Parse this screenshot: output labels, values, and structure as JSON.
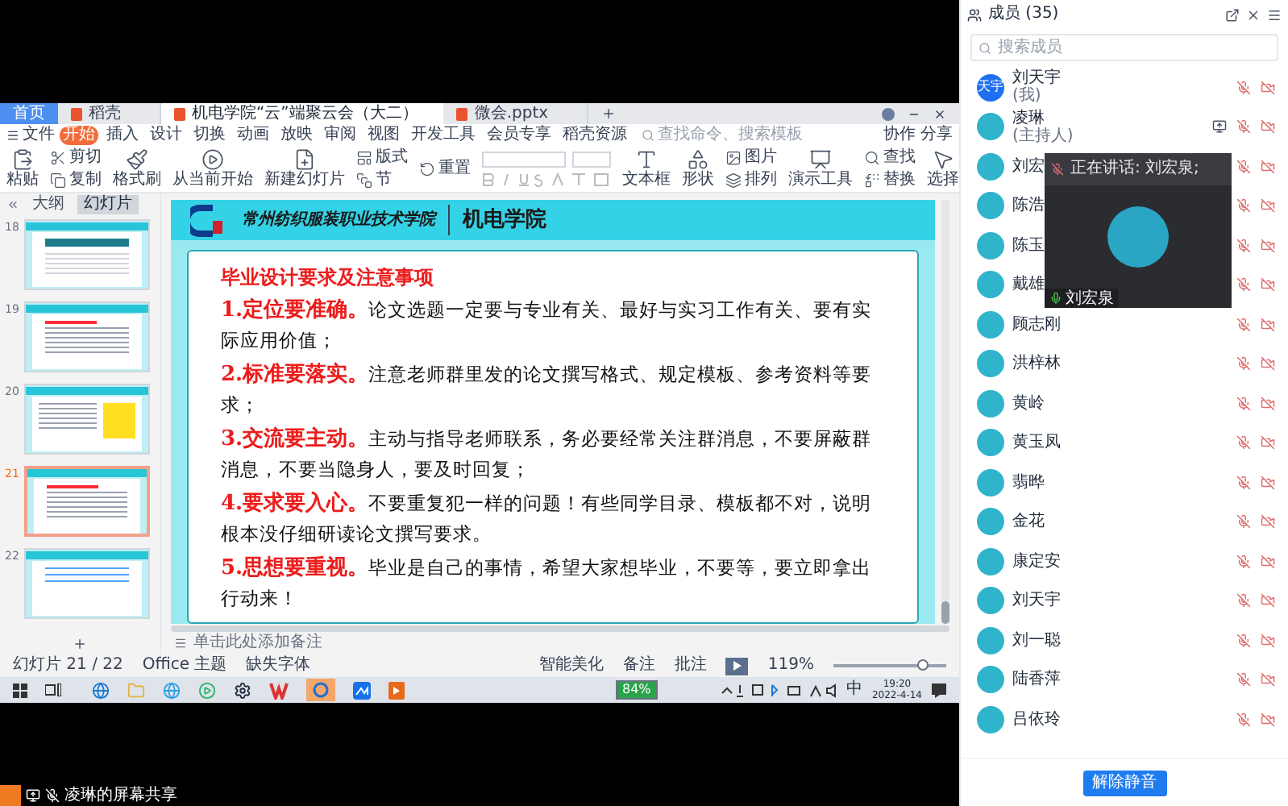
{
  "file_tabs": [
    {
      "label": "首页",
      "kind": "home",
      "selected": false
    },
    {
      "label": "稻壳",
      "kind": "doc",
      "selected": false
    },
    {
      "label": "机电学院“云”端聚云会（大二）",
      "kind": "doc",
      "selected": true
    },
    {
      "label": "微会.pptx",
      "kind": "doc",
      "selected": false
    }
  ],
  "menu": {
    "file": "文件",
    "tabs": [
      {
        "label": "开始",
        "selected": true
      },
      {
        "label": "插入",
        "selected": false
      },
      {
        "label": "设计",
        "selected": false
      },
      {
        "label": "切换",
        "selected": false
      },
      {
        "label": "动画",
        "selected": false
      },
      {
        "label": "放映",
        "selected": false
      },
      {
        "label": "审阅",
        "selected": false
      },
      {
        "label": "视图",
        "selected": false
      },
      {
        "label": "开发工具",
        "selected": false
      },
      {
        "label": "会员专享",
        "selected": false
      },
      {
        "label": "稻壳资源",
        "selected": false
      }
    ],
    "search_placeholder": "查找命令、搜索模板",
    "collab": "协作",
    "share": "分享"
  },
  "ribbon": [
    {
      "kind": "big",
      "label": "粘贴"
    },
    {
      "kind": "pair",
      "items": [
        {
          "label": "剪切"
        },
        {
          "label": "复制"
        }
      ]
    },
    {
      "kind": "big",
      "label": "格式刷"
    },
    {
      "kind": "big",
      "label": "从当前开始"
    },
    {
      "kind": "big",
      "label": "新建幻灯片"
    },
    {
      "kind": "pair",
      "items": [
        {
          "label": "版式"
        },
        {
          "label": "节"
        }
      ]
    },
    {
      "kind": "pair",
      "items": [
        {
          "label": "重置"
        }
      ]
    },
    {
      "kind": "font"
    },
    {
      "kind": "big",
      "label": "文本框"
    },
    {
      "kind": "big",
      "label": "形状"
    },
    {
      "kind": "pair",
      "items": [
        {
          "label": "图片"
        },
        {
          "label": "排列"
        }
      ]
    },
    {
      "kind": "big",
      "label": "演示工具"
    },
    {
      "kind": "pair",
      "items": [
        {
          "label": "查找"
        },
        {
          "label": "替换"
        }
      ]
    },
    {
      "kind": "big",
      "label": "选择"
    }
  ],
  "slide_panel": {
    "tabs": [
      {
        "label": "大纲",
        "selected": false
      },
      {
        "label": "幻灯片",
        "selected": true
      }
    ],
    "slides": [
      {
        "number": "18",
        "kind": "table",
        "selected": false
      },
      {
        "number": "19",
        "kind": "text",
        "selected": false
      },
      {
        "number": "20",
        "kind": "grid",
        "selected": false
      },
      {
        "number": "21",
        "kind": "text",
        "selected": true
      },
      {
        "number": "22",
        "kind": "note",
        "selected": false
      }
    ]
  },
  "slide": {
    "school": "常州纺织服装职业技术学院",
    "department": "机电学院",
    "title": "毕业设计要求及注意事项",
    "items": [
      {
        "head": "1.定位要准确。",
        "body": "论文选题一定要与专业有关、最好与实习工作有关、要有实际应用价值；"
      },
      {
        "head": "2.标准要落实。",
        "body": "注意老师群里发的论文撰写格式、规定模板、参考资料等要求；"
      },
      {
        "head": "3.交流要主动。",
        "body": "主动与指导老师联系，务必要经常关注群消息，不要屏蔽群消息，不要当隐身人，要及时回复；"
      },
      {
        "head": "4.要求要入心。",
        "body": "不要重复犯一样的问题！有些同学目录、模板都不对，说明根本没仔细研读论文撰写要求。"
      },
      {
        "head": "5.思想要重视。",
        "body": "毕业是自己的事情，希望大家想毕业，不要等，要立即拿出行动来！"
      }
    ]
  },
  "notes_placeholder": "单击此处添加备注",
  "status_bar": {
    "slide_count": "幻灯片 21 / 22",
    "theme": "Office 主题",
    "missing_fonts": "缺失字体",
    "beautify": "智能美化",
    "notes": "备注",
    "comments": "批注",
    "zoom": "119%",
    "zoom_slider": {
      "level": 0.78
    }
  },
  "taskbar": {
    "battery": "84%",
    "ime": "中",
    "time": "19:20",
    "date": "2022-4-14"
  },
  "share_label": "凌琳的屏幕共享",
  "members_panel": {
    "title": "成员 (35)",
    "search_placeholder": "搜索成员",
    "members": [
      {
        "name": "刘天宇",
        "note": "(我)",
        "avatar_text": "天宇",
        "sharing": false,
        "muted": true
      },
      {
        "name": "凌琳",
        "note": "(主持人)",
        "sharing": true,
        "muted": true
      },
      {
        "name": "刘宏",
        "sharing": false,
        "muted": true
      },
      {
        "name": "陈浩",
        "sharing": false,
        "muted": true
      },
      {
        "name": "陈玉",
        "sharing": false,
        "muted": true
      },
      {
        "name": "戴雄",
        "sharing": false,
        "muted": true
      },
      {
        "name": "顾志刚",
        "sharing": false,
        "muted": true
      },
      {
        "name": "洪梓林",
        "sharing": false,
        "muted": true
      },
      {
        "name": "黄岭",
        "sharing": false,
        "muted": true
      },
      {
        "name": "黄玉凤",
        "sharing": false,
        "muted": true
      },
      {
        "name": "翡晔",
        "sharing": false,
        "muted": true
      },
      {
        "name": "金花",
        "sharing": false,
        "muted": true
      },
      {
        "name": "康定安",
        "sharing": false,
        "muted": true
      },
      {
        "name": "刘天宇",
        "sharing": false,
        "muted": true
      },
      {
        "name": "刘一聪",
        "sharing": false,
        "muted": true
      },
      {
        "name": "陆香萍",
        "sharing": false,
        "muted": true
      },
      {
        "name": "吕依玲",
        "sharing": false,
        "muted": true
      }
    ],
    "speaker": {
      "caption": "正在讲话: 刘宏泉;",
      "name": "刘宏泉"
    },
    "unmute_button": "解除静音"
  }
}
